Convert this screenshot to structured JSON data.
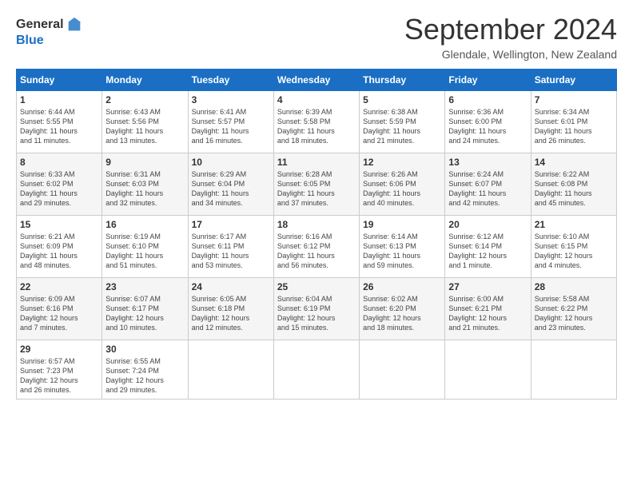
{
  "header": {
    "logo_general": "General",
    "logo_blue": "Blue",
    "month_title": "September 2024",
    "location": "Glendale, Wellington, New Zealand"
  },
  "days_of_week": [
    "Sunday",
    "Monday",
    "Tuesday",
    "Wednesday",
    "Thursday",
    "Friday",
    "Saturday"
  ],
  "weeks": [
    [
      {
        "day": "1",
        "sunrise": "6:44 AM",
        "sunset": "5:55 PM",
        "daylight": "11 hours and 11 minutes."
      },
      {
        "day": "2",
        "sunrise": "6:43 AM",
        "sunset": "5:56 PM",
        "daylight": "11 hours and 13 minutes."
      },
      {
        "day": "3",
        "sunrise": "6:41 AM",
        "sunset": "5:57 PM",
        "daylight": "11 hours and 16 minutes."
      },
      {
        "day": "4",
        "sunrise": "6:39 AM",
        "sunset": "5:58 PM",
        "daylight": "11 hours and 18 minutes."
      },
      {
        "day": "5",
        "sunrise": "6:38 AM",
        "sunset": "5:59 PM",
        "daylight": "11 hours and 21 minutes."
      },
      {
        "day": "6",
        "sunrise": "6:36 AM",
        "sunset": "6:00 PM",
        "daylight": "11 hours and 24 minutes."
      },
      {
        "day": "7",
        "sunrise": "6:34 AM",
        "sunset": "6:01 PM",
        "daylight": "11 hours and 26 minutes."
      }
    ],
    [
      {
        "day": "8",
        "sunrise": "6:33 AM",
        "sunset": "6:02 PM",
        "daylight": "11 hours and 29 minutes."
      },
      {
        "day": "9",
        "sunrise": "6:31 AM",
        "sunset": "6:03 PM",
        "daylight": "11 hours and 32 minutes."
      },
      {
        "day": "10",
        "sunrise": "6:29 AM",
        "sunset": "6:04 PM",
        "daylight": "11 hours and 34 minutes."
      },
      {
        "day": "11",
        "sunrise": "6:28 AM",
        "sunset": "6:05 PM",
        "daylight": "11 hours and 37 minutes."
      },
      {
        "day": "12",
        "sunrise": "6:26 AM",
        "sunset": "6:06 PM",
        "daylight": "11 hours and 40 minutes."
      },
      {
        "day": "13",
        "sunrise": "6:24 AM",
        "sunset": "6:07 PM",
        "daylight": "11 hours and 42 minutes."
      },
      {
        "day": "14",
        "sunrise": "6:22 AM",
        "sunset": "6:08 PM",
        "daylight": "11 hours and 45 minutes."
      }
    ],
    [
      {
        "day": "15",
        "sunrise": "6:21 AM",
        "sunset": "6:09 PM",
        "daylight": "11 hours and 48 minutes."
      },
      {
        "day": "16",
        "sunrise": "6:19 AM",
        "sunset": "6:10 PM",
        "daylight": "11 hours and 51 minutes."
      },
      {
        "day": "17",
        "sunrise": "6:17 AM",
        "sunset": "6:11 PM",
        "daylight": "11 hours and 53 minutes."
      },
      {
        "day": "18",
        "sunrise": "6:16 AM",
        "sunset": "6:12 PM",
        "daylight": "11 hours and 56 minutes."
      },
      {
        "day": "19",
        "sunrise": "6:14 AM",
        "sunset": "6:13 PM",
        "daylight": "11 hours and 59 minutes."
      },
      {
        "day": "20",
        "sunrise": "6:12 AM",
        "sunset": "6:14 PM",
        "daylight": "12 hours and 1 minute."
      },
      {
        "day": "21",
        "sunrise": "6:10 AM",
        "sunset": "6:15 PM",
        "daylight": "12 hours and 4 minutes."
      }
    ],
    [
      {
        "day": "22",
        "sunrise": "6:09 AM",
        "sunset": "6:16 PM",
        "daylight": "12 hours and 7 minutes."
      },
      {
        "day": "23",
        "sunrise": "6:07 AM",
        "sunset": "6:17 PM",
        "daylight": "12 hours and 10 minutes."
      },
      {
        "day": "24",
        "sunrise": "6:05 AM",
        "sunset": "6:18 PM",
        "daylight": "12 hours and 12 minutes."
      },
      {
        "day": "25",
        "sunrise": "6:04 AM",
        "sunset": "6:19 PM",
        "daylight": "12 hours and 15 minutes."
      },
      {
        "day": "26",
        "sunrise": "6:02 AM",
        "sunset": "6:20 PM",
        "daylight": "12 hours and 18 minutes."
      },
      {
        "day": "27",
        "sunrise": "6:00 AM",
        "sunset": "6:21 PM",
        "daylight": "12 hours and 21 minutes."
      },
      {
        "day": "28",
        "sunrise": "5:58 AM",
        "sunset": "6:22 PM",
        "daylight": "12 hours and 23 minutes."
      }
    ],
    [
      {
        "day": "29",
        "sunrise": "6:57 AM",
        "sunset": "7:23 PM",
        "daylight": "12 hours and 26 minutes."
      },
      {
        "day": "30",
        "sunrise": "6:55 AM",
        "sunset": "7:24 PM",
        "daylight": "12 hours and 29 minutes."
      },
      null,
      null,
      null,
      null,
      null
    ]
  ]
}
